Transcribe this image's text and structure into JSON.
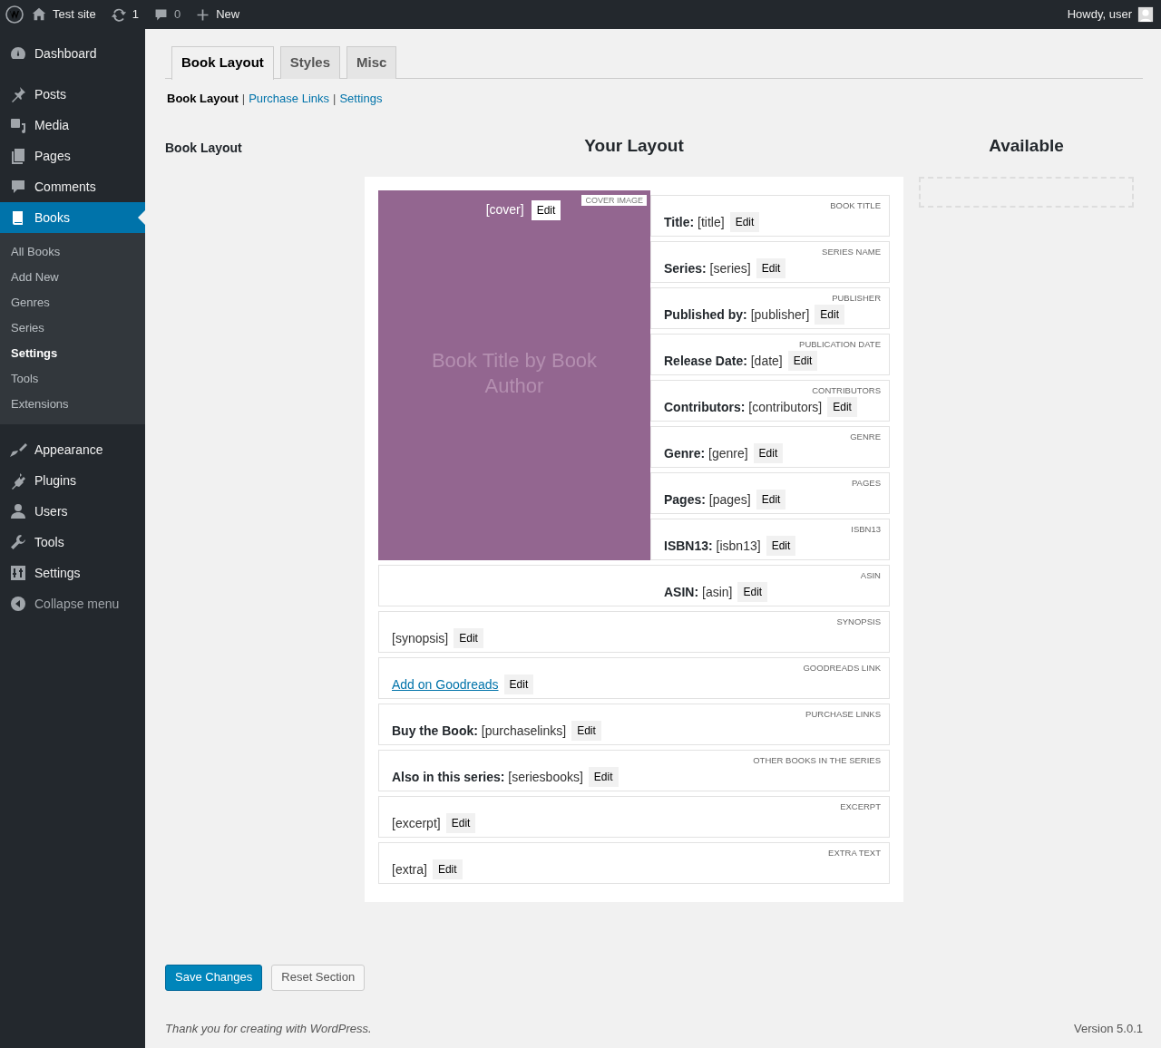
{
  "admin_bar": {
    "site": "Test site",
    "updates": "1",
    "comments": "0",
    "new": "New",
    "greeting": "Howdy, user"
  },
  "sidebar": {
    "items": [
      {
        "label": "Dashboard",
        "selected": false
      },
      {
        "label": "Posts",
        "selected": false
      },
      {
        "label": "Media",
        "selected": false
      },
      {
        "label": "Pages",
        "selected": false
      },
      {
        "label": "Comments",
        "selected": false
      },
      {
        "label": "Books",
        "selected": true,
        "children": [
          {
            "label": "All Books",
            "selected": false
          },
          {
            "label": "Add New",
            "selected": false
          },
          {
            "label": "Genres",
            "selected": false
          },
          {
            "label": "Series",
            "selected": false
          },
          {
            "label": "Settings",
            "selected": true
          },
          {
            "label": "Tools",
            "selected": false
          },
          {
            "label": "Extensions",
            "selected": false
          }
        ]
      },
      {
        "label": "Appearance",
        "selected": false
      },
      {
        "label": "Plugins",
        "selected": false
      },
      {
        "label": "Users",
        "selected": false
      },
      {
        "label": "Tools",
        "selected": false
      },
      {
        "label": "Settings",
        "selected": false
      },
      {
        "label": "Collapse menu",
        "selected": false
      }
    ]
  },
  "tabs": [
    {
      "label": "Book Layout",
      "selected": true
    },
    {
      "label": "Styles",
      "selected": false
    },
    {
      "label": "Misc",
      "selected": false
    }
  ],
  "subnav": [
    {
      "label": "Book Layout",
      "selected": true
    },
    {
      "label": "Purchase Links",
      "selected": false,
      "prefix": "|"
    },
    {
      "label": "Settings",
      "selected": false,
      "prefix": "|"
    }
  ],
  "section_title": "Book Layout",
  "layout_heading": "Your Layout",
  "available_heading": "Available",
  "cover": {
    "text": "[cover]",
    "button": "Edit",
    "tag": "COVER IMAGE",
    "placeholder": "Book Title by Book Author"
  },
  "fields": [
    {
      "kind": "text",
      "text": "**Title:** [title]",
      "button": "Edit",
      "tag": "BOOK TITLE"
    },
    {
      "kind": "text",
      "text": "**Series:** [series]",
      "button": "Edit",
      "tag": "SERIES NAME"
    },
    {
      "kind": "text",
      "text": "**Published by:** [publisher]",
      "button": "Edit",
      "tag": "PUBLISHER"
    },
    {
      "kind": "text",
      "text": "**Release Date:** [date]",
      "button": "Edit",
      "tag": "PUBLICATION DATE"
    },
    {
      "kind": "text",
      "text": "**Contributors:** [contributors]",
      "button": "Edit",
      "tag": "CONTRIBUTORS"
    },
    {
      "kind": "text",
      "text": "**Genre:** [genre]",
      "button": "Edit",
      "tag": "GENRE"
    },
    {
      "kind": "text",
      "text": "**Pages:** [pages]",
      "button": "Edit",
      "tag": "PAGES"
    },
    {
      "kind": "text",
      "text": "**ISBN13:** [isbn13]",
      "button": "Edit",
      "tag": "ISBN13"
    },
    {
      "kind": "text",
      "text": "**ASIN:** [asin]",
      "button": "Edit",
      "tag": "ASIN"
    },
    {
      "kind": "text",
      "text": "[synopsis]",
      "button": "Edit",
      "tag": "SYNOPSIS"
    },
    {
      "kind": "link",
      "text": "Add on Goodreads",
      "button": "Edit",
      "tag": "GOODREADS LINK"
    },
    {
      "kind": "text",
      "text": "**Buy the Book:** [purchaselinks]",
      "button": "Edit",
      "tag": "PURCHASE LINKS"
    },
    {
      "kind": "text",
      "text": "**Also in this series:** [seriesbooks]",
      "button": "Edit",
      "tag": "OTHER BOOKS IN THE SERIES"
    },
    {
      "kind": "text",
      "text": "[excerpt]",
      "button": "Edit",
      "tag": "EXCERPT"
    },
    {
      "kind": "text",
      "text": "[extra]",
      "button": "Edit",
      "tag": "EXTRA TEXT"
    }
  ],
  "buttons": [
    {
      "label": "Save Changes",
      "kind": "primary"
    },
    {
      "label": "Reset Section",
      "kind": "secondary"
    }
  ],
  "footer": {
    "text": "Thank you for creating with ",
    "link": "WordPress",
    "end": ".",
    "version": "Version 5.0.1"
  }
}
